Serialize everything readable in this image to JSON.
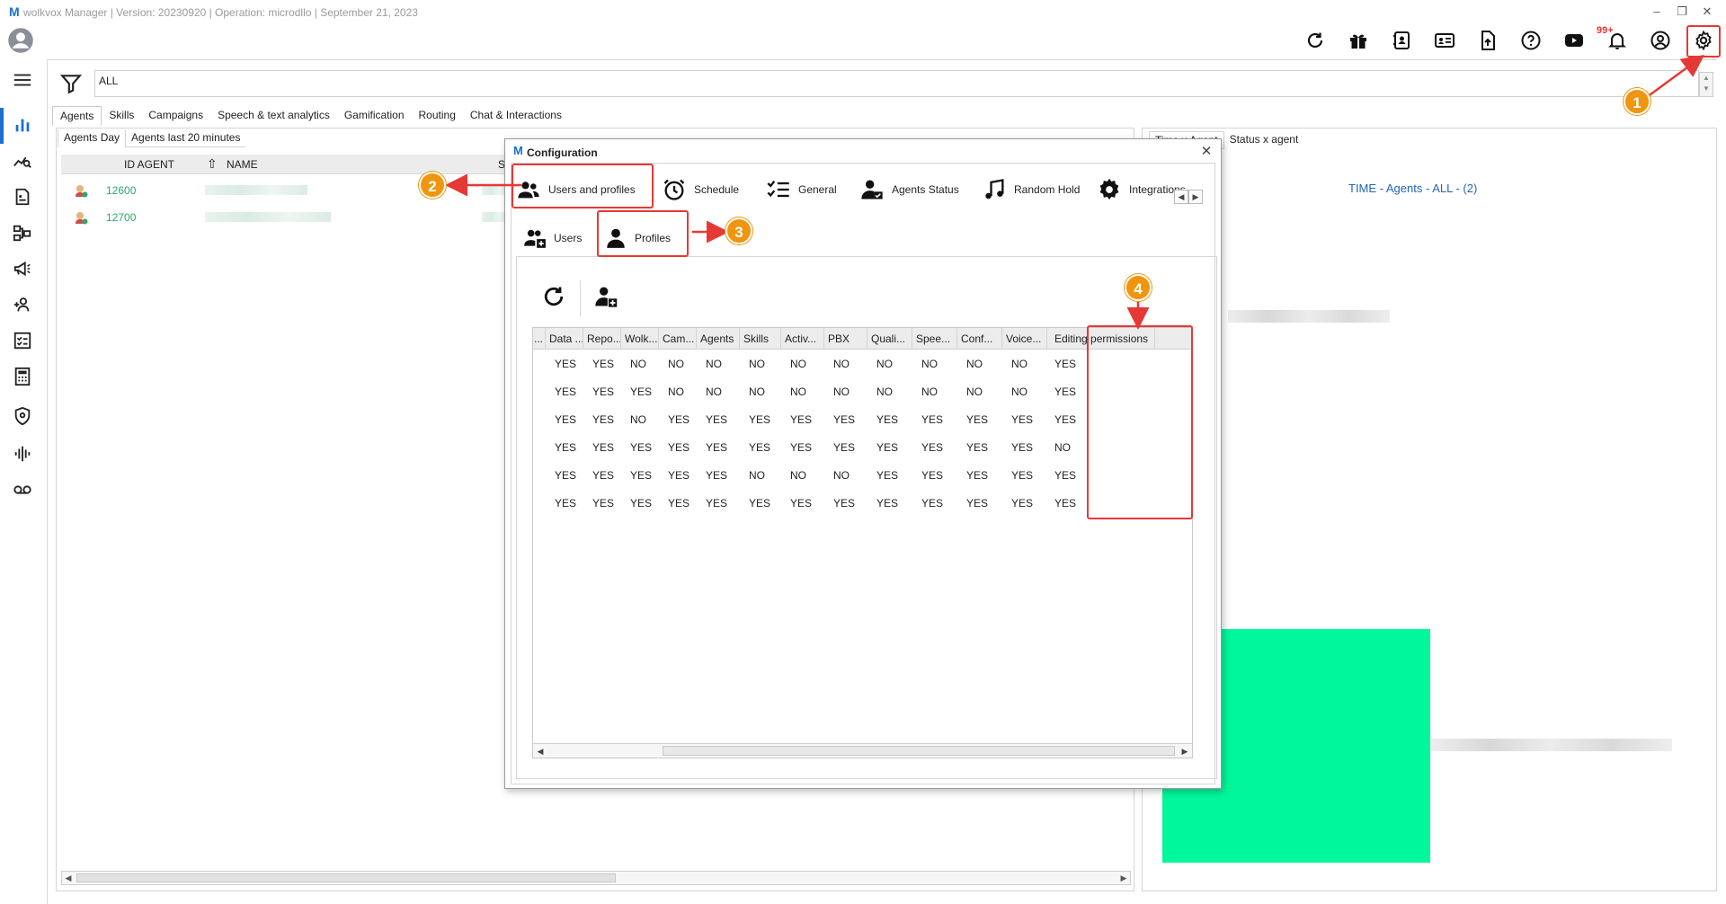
{
  "window": {
    "title": "wolkvox Manager  | Version: 20230920 |  Operation: microdllo | September 21, 2023",
    "logo": "M"
  },
  "toolbar_icons": [
    "refresh-icon",
    "gift-icon",
    "contacts-book-icon",
    "id-card-icon",
    "upload-file-icon",
    "help-icon",
    "youtube-icon",
    "notifications-icon",
    "user-circle-icon",
    "settings-gear-icon"
  ],
  "notifications_badge": "99+",
  "filter": {
    "value": "ALL"
  },
  "main_tabs": [
    "Agents",
    "Skills",
    "Campaigns",
    "Speech & text analytics",
    "Gamification",
    "Routing",
    "Chat & Interactions"
  ],
  "sub_tabs": [
    "Agents Day",
    "Agents last 20 minutes"
  ],
  "agents_grid": {
    "columns": [
      "ID AGENT",
      "NAME",
      "S"
    ],
    "rows": [
      {
        "id": "12600"
      },
      {
        "id": "12700"
      }
    ]
  },
  "right_panel": {
    "tabs": [
      "Time x Agent",
      "Status x agent"
    ],
    "chart_title": "TIME - Agents - ALL -  (2)"
  },
  "dialog": {
    "logo": "M",
    "title": "Configuration",
    "close": "✕",
    "tabs": [
      "Users and profiles",
      "Schedule",
      "General",
      "Agents Status",
      "Random Hold",
      "Integrations"
    ],
    "subtabs": [
      "Users",
      "Profiles"
    ],
    "profiles_table": {
      "columns": [
        "...",
        "Data ...",
        "Repo...",
        "Wolk...",
        "Cam...",
        "Agents",
        "Skills",
        "Activ...",
        "PBX",
        "Quali...",
        "Spee...",
        "Conf...",
        "Voice...",
        "Editing permissions"
      ],
      "rows": [
        [
          "",
          "YES",
          "YES",
          "NO",
          "NO",
          "NO",
          "NO",
          "NO",
          "NO",
          "NO",
          "NO",
          "NO",
          "NO",
          "YES"
        ],
        [
          "",
          "YES",
          "YES",
          "YES",
          "NO",
          "NO",
          "NO",
          "NO",
          "NO",
          "NO",
          "NO",
          "NO",
          "NO",
          "YES"
        ],
        [
          "",
          "YES",
          "YES",
          "NO",
          "YES",
          "YES",
          "YES",
          "YES",
          "YES",
          "YES",
          "YES",
          "YES",
          "YES",
          "YES"
        ],
        [
          "",
          "YES",
          "YES",
          "YES",
          "YES",
          "YES",
          "YES",
          "YES",
          "YES",
          "YES",
          "YES",
          "YES",
          "YES",
          "NO"
        ],
        [
          "",
          "YES",
          "YES",
          "YES",
          "YES",
          "YES",
          "NO",
          "NO",
          "NO",
          "YES",
          "YES",
          "YES",
          "YES",
          "YES"
        ],
        [
          "",
          "YES",
          "YES",
          "YES",
          "YES",
          "YES",
          "YES",
          "YES",
          "YES",
          "YES",
          "YES",
          "YES",
          "YES",
          "YES"
        ]
      ]
    }
  },
  "annotations": {
    "step1": "1",
    "step2": "2",
    "step3": "3",
    "step4": "4",
    "color": "#e53935",
    "badge_color": "#f0950f"
  }
}
